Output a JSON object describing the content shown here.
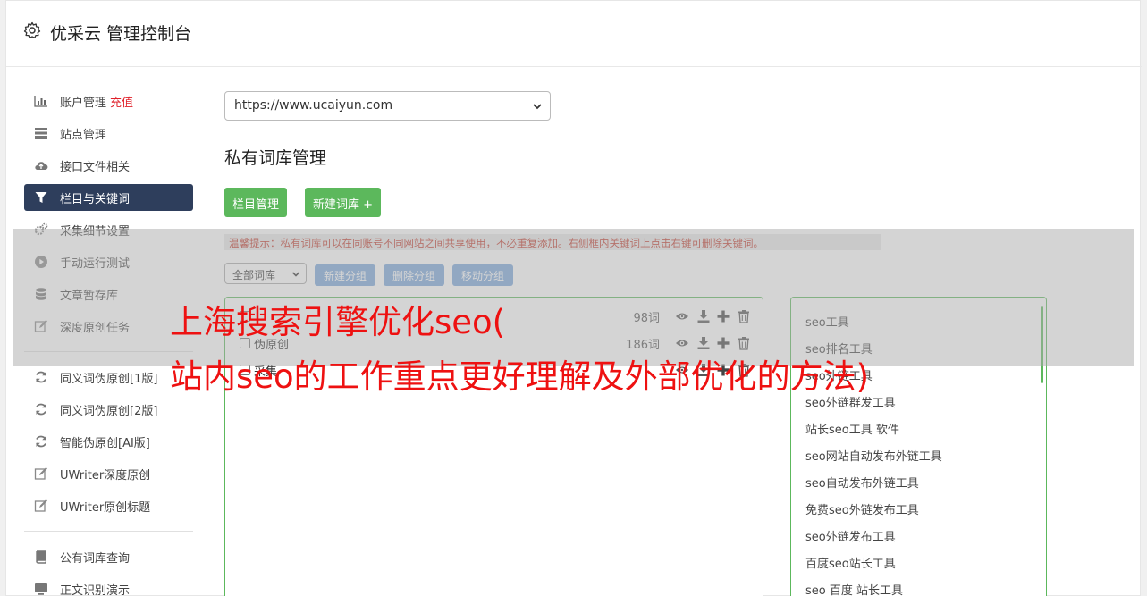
{
  "header": {
    "title": "优采云 管理控制台",
    "icon": "gear-icon"
  },
  "sidebar": {
    "items": [
      {
        "label": "账户管理",
        "badge": "充值",
        "icon": "bar-chart-icon"
      },
      {
        "label": "站点管理",
        "icon": "server-icon"
      },
      {
        "label": "接口文件相关",
        "icon": "cloud-upload-icon"
      },
      {
        "label": "栏目与关键词",
        "icon": "filter-icon",
        "active": true
      },
      {
        "label": "采集细节设置",
        "icon": "gears-icon"
      },
      {
        "label": "手动运行测试",
        "icon": "play-circle-icon"
      },
      {
        "label": "文章暂存库",
        "icon": "database-icon"
      },
      {
        "label": "深度原创任务",
        "icon": "edit-icon"
      },
      {
        "label": "同义词伪原创[1版]",
        "icon": "refresh-icon"
      },
      {
        "label": "同义词伪原创[2版]",
        "icon": "refresh-icon"
      },
      {
        "label": "智能伪原创[AI版]",
        "icon": "refresh-icon"
      },
      {
        "label": "UWriter深度原创",
        "icon": "edit-icon"
      },
      {
        "label": "UWriter原创标题",
        "icon": "edit-icon"
      },
      {
        "label": "公有词库查询",
        "icon": "book-icon"
      },
      {
        "label": "正文识别演示",
        "icon": "monitor-icon"
      }
    ]
  },
  "main": {
    "site_select": "https://www.ucaiyun.com",
    "section_title": "私有词库管理",
    "buttons": {
      "column_manage": "栏目管理",
      "new_library": "新建词库 +"
    },
    "tip": "温馨提示：私有词库可以在同账号不同网站之间共享使用，不必重复添加。右侧框内关键词上点击右键可删除关键词。",
    "library_select": "全部词库",
    "group_buttons": {
      "new_group": "新建分组",
      "delete_group": "删除分组",
      "move_group": "移动分组"
    },
    "groups": [
      {
        "name": "",
        "count": "98词"
      },
      {
        "name": "伪原创",
        "count": "186词"
      },
      {
        "name": "采集",
        "count": ""
      }
    ],
    "keywords": [
      "seo工具",
      "seo排名工具",
      "seo外链工具",
      "seo外链群发工具",
      "站长seo工具 软件",
      "seo网站自动发布外链工具",
      "seo自动发布外链工具",
      "免费seo外链发布工具",
      "seo外链发布工具",
      "百度seo站长工具",
      "seo 百度 站长工具"
    ]
  },
  "overlay_headline": {
    "line1": "上海搜索引擎优化seo(",
    "line2": "站内seo的工作重点更好理解及外部优化的方法)"
  },
  "colors": {
    "accent_green": "#5cb85c",
    "nav_active": "#2e3e5c",
    "headline_red": "#ee1111",
    "recharge_red": "#e0202a",
    "group_button_blue": "#7ba7db"
  }
}
